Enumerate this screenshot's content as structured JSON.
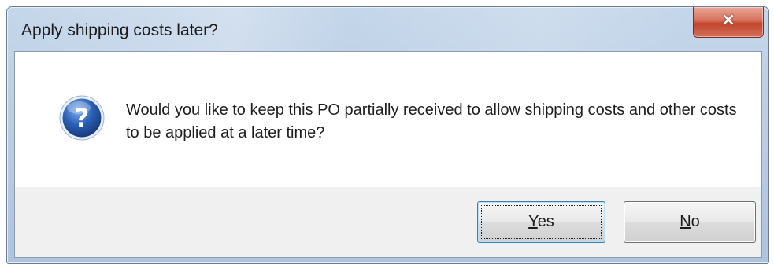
{
  "dialog": {
    "title": "Apply shipping costs later?",
    "close_glyph": "×",
    "message": "Would you like to keep this PO partially received to allow shipping costs and other costs to be applied at a later time?",
    "icon": "question-icon",
    "buttons": {
      "yes": {
        "accel": "Y",
        "rest": "es",
        "default": true
      },
      "no": {
        "accel": "N",
        "rest": "o",
        "default": false
      }
    }
  },
  "colors": {
    "frame": "#b9cde3",
    "close_button": "#c2452c",
    "icon_blue": "#2a5fb5",
    "content_bg": "#ffffff",
    "button_area_bg": "#f0f0f0"
  }
}
